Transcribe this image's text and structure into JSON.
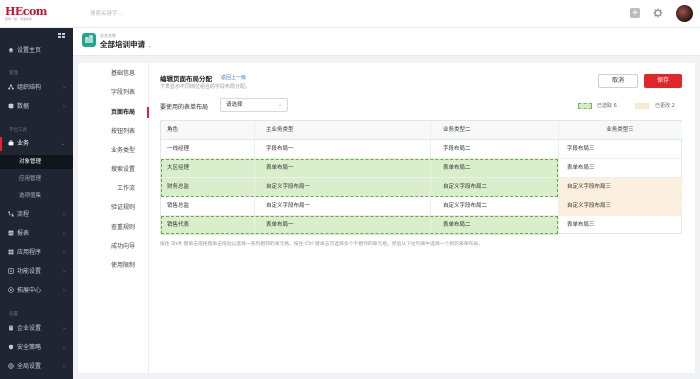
{
  "topbar": {
    "logo_text": "HEcom",
    "logo_slogan": "和你一起，创造未来",
    "search_placeholder": "搜索关键字..."
  },
  "sidebar": {
    "items": [
      {
        "label": "设置主页",
        "icon": "home-icon"
      },
      {
        "group": "管理"
      },
      {
        "label": "组织结构",
        "icon": "org-icon",
        "arrow": "›"
      },
      {
        "label": "数据",
        "icon": "data-icon",
        "arrow": "›"
      },
      {
        "group": "平台工具"
      },
      {
        "label": "业务",
        "icon": "business-icon",
        "arrow": "⌄"
      },
      {
        "sub": "对象管理"
      },
      {
        "sub": "应用管理"
      },
      {
        "sub": "选项值集"
      },
      {
        "label": "流程",
        "icon": "flow-icon",
        "arrow": "›"
      },
      {
        "label": "报表",
        "icon": "report-icon",
        "arrow": "›"
      },
      {
        "label": "应用程序",
        "icon": "apps-icon",
        "arrow": "›"
      },
      {
        "label": "功能设置",
        "icon": "feature-icon",
        "arrow": "›"
      },
      {
        "label": "拓展中心",
        "icon": "extension-icon",
        "arrow": "›"
      },
      {
        "group": "设置"
      },
      {
        "label": "企业设置",
        "icon": "company-icon",
        "arrow": "›"
      },
      {
        "label": "安全策略",
        "icon": "security-icon",
        "arrow": "›"
      },
      {
        "label": "全局设置",
        "icon": "global-icon",
        "arrow": "›"
      }
    ]
  },
  "header": {
    "subtitle": "业务名称",
    "title": "全部培训申请"
  },
  "tabs": [
    "基础信息",
    "字段列表",
    "页面布局",
    "按钮列表",
    "业务类型",
    "搜索设置",
    "工作流",
    "验证规则",
    "查重规则",
    "成功向导",
    "使用限制"
  ],
  "panel": {
    "title": "编辑页面布局分配",
    "back_link": "返回上一级",
    "desc": "下表显示不同岗位组合的字段布局分配。",
    "cancel": "取消",
    "save": "保存",
    "select_label": "要使用的表单布局",
    "select_value": "请选择",
    "legend_selected": "已选取 6",
    "legend_changed": "已更改 2",
    "hint": "按住 Shift 键单击或拖拽单击拖动以选择一系列相邻的单元格。按住 Ctrl 键单击可选择多个不相邻的单元格。然后从下拉列表中选择一个新的表单布局。"
  },
  "grid": {
    "headers": [
      "角色",
      "主业务类型",
      "业务类型二",
      "业务类型三"
    ],
    "rows": [
      [
        "一线经理",
        "字段布局一",
        "字段布局二",
        "字段布局三"
      ],
      [
        "大区经理",
        "表单布局一",
        "表单布局二",
        "表单布局三"
      ],
      [
        "财务总监",
        "自定义字段布局一",
        "自定义字段布局二",
        "自定义字段布局三"
      ],
      [
        "销售总监",
        "自定义字段布局一",
        "自定义字段布局二",
        "自定义字段布局三"
      ],
      [
        "销售代表",
        "表单布局一",
        "表单布局二",
        "表单布局三"
      ]
    ]
  },
  "colors": {
    "accent": "#e0262a",
    "selected": "#d9eecb",
    "changed": "#fdefde",
    "link": "#2d7bd8"
  }
}
